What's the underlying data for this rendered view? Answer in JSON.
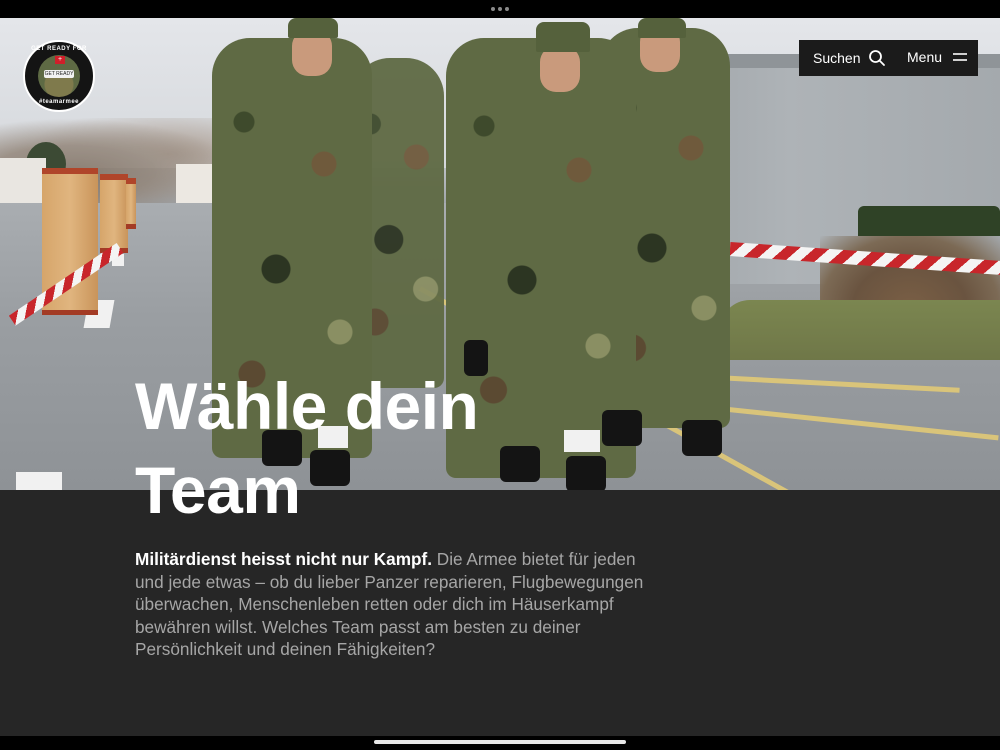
{
  "badge": {
    "top_text": "GET READY FOR",
    "bottom_text": "#teamarmee",
    "arc_text": "GET READY",
    "flag_symbol": "+"
  },
  "nav": {
    "search_label": "Suchen",
    "search_icon": "search-icon",
    "menu_label": "Menu",
    "menu_icon": "hamburger-menu-icon"
  },
  "hero": {
    "headline": "Wähle dein Team",
    "lead_bold": "Militärdienst heisst nicht nur Kampf.",
    "lead_rest": " Die Armee bietet für jeden und jede etwas – ob du lieber Panzer reparieren, Flugbewegungen überwachen, Menschenleben retten oder dich im Häuserkampf bewähren willst. Welches Team passt am besten zu deiner Persönlichkeit und deinen Fähigkeiten?"
  },
  "colors": {
    "nav_background": "#1b1b1b",
    "panel_background": "#262626",
    "lead_text": "#a6a6a6",
    "tape_red": "#c8262b"
  }
}
